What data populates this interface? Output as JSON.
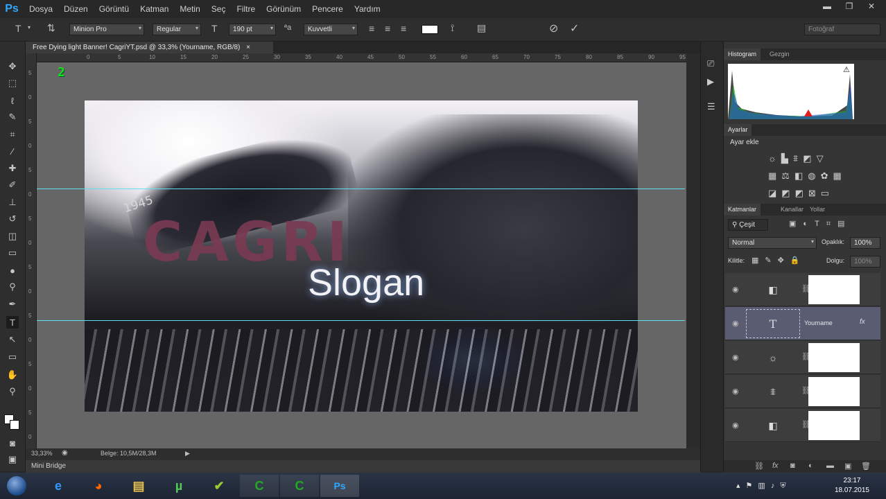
{
  "app": {
    "logo": "Ps"
  },
  "menu": [
    "Dosya",
    "Düzen",
    "Görüntü",
    "Katman",
    "Metin",
    "Seç",
    "Filtre",
    "Görünüm",
    "Pencere",
    "Yardım"
  ],
  "window_controls": {
    "minimize": "▬",
    "restore": "❐",
    "close": "✕"
  },
  "options": {
    "font_family": "Minion Pro",
    "font_style": "Regular",
    "font_size": "190 pt",
    "antialias": "Kuvvetli",
    "aa_label": "ªa",
    "workspace": "Fotoğraf"
  },
  "document": {
    "tab_title": "Free Dying light Banner! CagriYT.psd @ 33,3% (Yourname, RGB/8)",
    "tab_close": "×",
    "zoom": "33,33%",
    "doc_info": "Belge: 10,5M/28,3M",
    "overlay_number": "2"
  },
  "ruler_top_ticks": [
    "0",
    "5",
    "10",
    "15",
    "20",
    "25",
    "30",
    "35",
    "40",
    "45",
    "50",
    "55",
    "60",
    "65",
    "70",
    "75",
    "80",
    "85",
    "90",
    "95"
  ],
  "ruler_left_ticks": [
    "5",
    "0",
    "5",
    "0",
    "5",
    "0",
    "5",
    "0",
    "5",
    "0",
    "5",
    "0",
    "5",
    "0",
    "5",
    "0"
  ],
  "canvas_text": {
    "brand": "CAGRI",
    "slogan": "Slogan",
    "stamp": "1945"
  },
  "mini_bridge": "Mini Bridge",
  "panels": {
    "histogram_tabs": [
      "Histogram",
      "Gezgin"
    ],
    "adjust_tab": "Ayarlar",
    "adjust_label": "Ayar ekle",
    "layers_tabs": [
      "Katmanlar",
      "Kanallar",
      "Yollar"
    ],
    "filter_kind": "Çeşit",
    "blend_mode": "Normal",
    "opacity_label": "Opaklık:",
    "opacity_value": "100%",
    "lock_label": "Kilitle:",
    "fill_label": "Dolgu:",
    "fill_value": "100%",
    "layers": [
      {
        "name": "",
        "thumb": "◧",
        "selected": false
      },
      {
        "name": "Yourname",
        "thumb": "T",
        "selected": true,
        "fx": "fx"
      },
      {
        "name": "",
        "thumb": "☼",
        "selected": false
      },
      {
        "name": "",
        "thumb": "⩨",
        "selected": false
      },
      {
        "name": "",
        "thumb": "◧",
        "selected": false
      }
    ]
  },
  "taskbar": {
    "time": "23:17",
    "date": "18.07.2015"
  }
}
